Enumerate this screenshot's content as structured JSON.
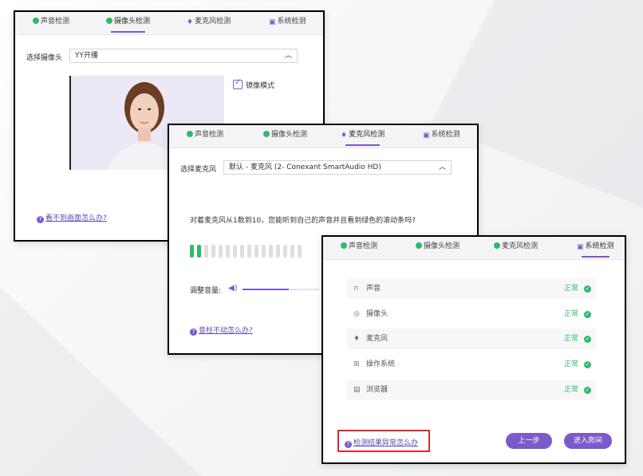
{
  "tabs": [
    "声音检测",
    "摄像头检测",
    "麦克风检测",
    "系统检测"
  ],
  "panel_camera": {
    "active_tab": 1,
    "select_label": "选择摄像头",
    "select_value": "YY开播",
    "mirror_label": "镜像模式",
    "mirror_checked": true,
    "help_link": "看不到画面怎么办?"
  },
  "panel_mic": {
    "active_tab": 2,
    "select_label": "选择麦克风",
    "select_value": "默认 - 麦克风 (2- Conexant SmartAudio HD)",
    "instruction": "对着麦克风从1数到10，您能听到自己的声音并且看到绿色的滚动条吗?",
    "level_active_bars": 2,
    "level_total_bars": 16,
    "volume_label": "调整音量:",
    "volume_level": 0.6,
    "help_link": "音柱不动怎么办?"
  },
  "panel_system": {
    "active_tab": 3,
    "items": [
      {
        "icon": "headphones-icon",
        "name": "声音",
        "status": "正常"
      },
      {
        "icon": "camera-icon",
        "name": "摄像头",
        "status": "正常"
      },
      {
        "icon": "microphone-icon",
        "name": "麦克风",
        "status": "正常"
      },
      {
        "icon": "windows-icon",
        "name": "操作系统",
        "status": "正常"
      },
      {
        "icon": "browser-icon",
        "name": "浏览器",
        "status": "正常"
      }
    ],
    "help_link": "检测结果异常怎么办",
    "prev_button": "上一步",
    "enter_button": "进入房间"
  },
  "colors": {
    "accent": "#7a5bc9",
    "ok": "#2dbb6a",
    "highlight": "#e0262b"
  }
}
